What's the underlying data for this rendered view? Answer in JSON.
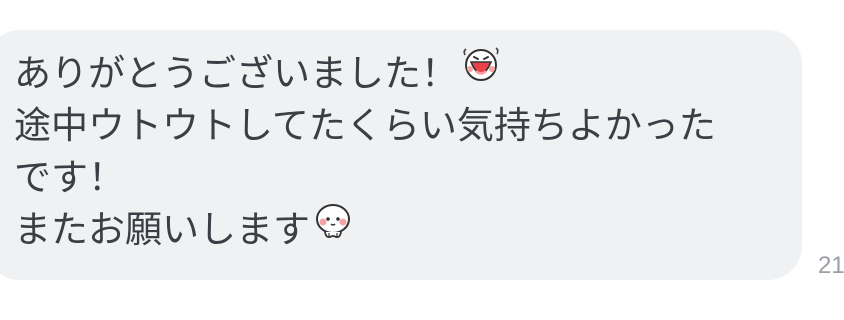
{
  "message": {
    "lines": [
      "ありがとうございました！",
      "途中ウトウトしてたくらい気持ちよかった",
      "です！",
      "またお願いします"
    ],
    "emojis": [
      "laughing-face-sticker-icon",
      "blushing-face-sticker-icon"
    ],
    "bubble_color": "#f0f1f3",
    "text_color": "#3b3f45"
  },
  "timestamp": "21"
}
